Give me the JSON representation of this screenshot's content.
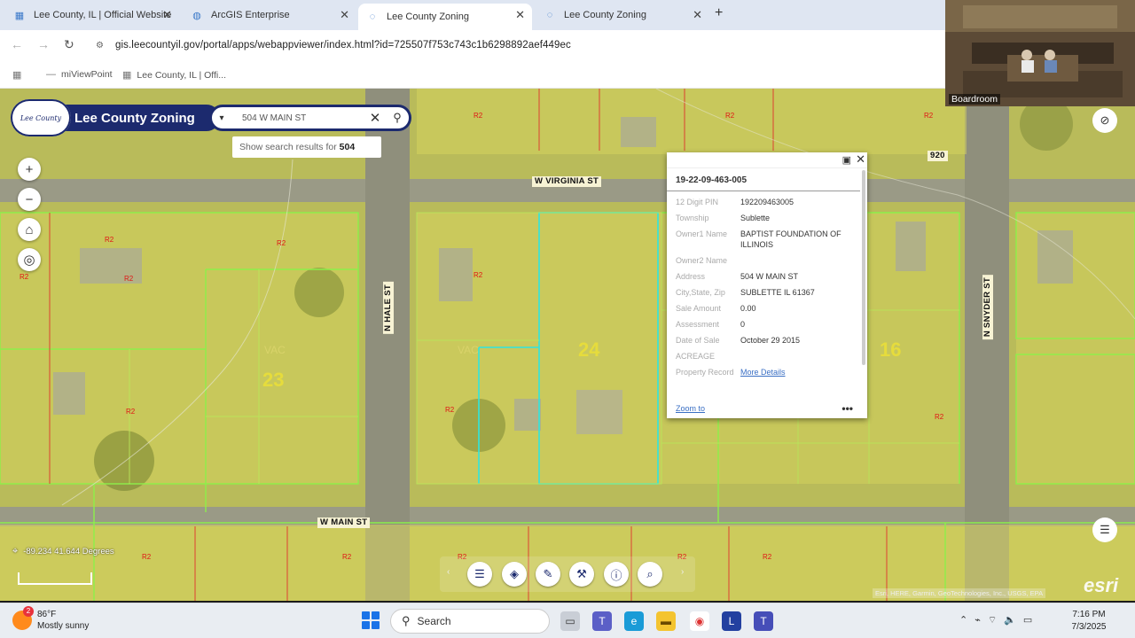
{
  "browser": {
    "tabs": [
      {
        "label": "Lee County, IL | Official Website",
        "icon": "grid-icon",
        "active": false
      },
      {
        "label": "ArcGIS Enterprise",
        "icon": "globe-icon",
        "active": false
      },
      {
        "label": "Lee County Zoning",
        "icon": "arcgis-icon",
        "active": true
      },
      {
        "label": "Lee County Zoning",
        "icon": "arcgis-icon",
        "active": false
      }
    ],
    "url": "gis.leecountyil.gov/portal/apps/webappviewer/index.html?id=725507f753c743c1b6298892aef449ec",
    "bookmarks": [
      {
        "label": "miViewPoint"
      },
      {
        "label": "Lee County, IL | Offi..."
      }
    ]
  },
  "app": {
    "logo_text": "Lee County",
    "title": "Lee County Zoning",
    "search_value": "504 W MAIN  ST",
    "suggest_prefix": "Show search results for ",
    "suggest_term": "504"
  },
  "map": {
    "streets": {
      "virginia": "W VIRGINIA ST",
      "main": "W MAIN ST",
      "hale": "N HALE ST",
      "snyder": "N SNYDER ST",
      "route": "920"
    },
    "zone_code": "R2",
    "vac_label": "VAC",
    "block_numbers": [
      "24",
      "23",
      "16"
    ],
    "coords": "-89.234 41.644 Degrees",
    "attribution": "Esri, HERE, Garmin, GeoTechnologies, Inc., USGS, EPA",
    "brand": "esri"
  },
  "popup": {
    "title": "19-22-09-463-005",
    "rows": [
      {
        "k": "12 Digit PIN",
        "v": "192209463005"
      },
      {
        "k": "Township",
        "v": "Sublette"
      },
      {
        "k": "Owner1 Name",
        "v": "BAPTIST FOUNDATION OF ILLINOIS"
      },
      {
        "k": "Owner2 Name",
        "v": ""
      },
      {
        "k": "Address",
        "v": "504 W MAIN ST"
      },
      {
        "k": "City,State, Zip",
        "v": "SUBLETTE IL 61367"
      },
      {
        "k": "Sale Amount",
        "v": "0.00"
      },
      {
        "k": "Assessment",
        "v": "0"
      },
      {
        "k": "Date of Sale",
        "v": "October 29 2015"
      },
      {
        "k": "ACREAGE",
        "v": ""
      },
      {
        "k": "Property Record",
        "v": "More Details"
      }
    ],
    "zoom_to": "Zoom to",
    "more": "•••"
  },
  "video": {
    "label": "Boardroom"
  },
  "taskbar": {
    "temp": "86°F",
    "condition": "Mostly sunny",
    "badge": "2",
    "search_label": "Search",
    "time": "7:16 PM",
    "date": "7/3/2025"
  }
}
